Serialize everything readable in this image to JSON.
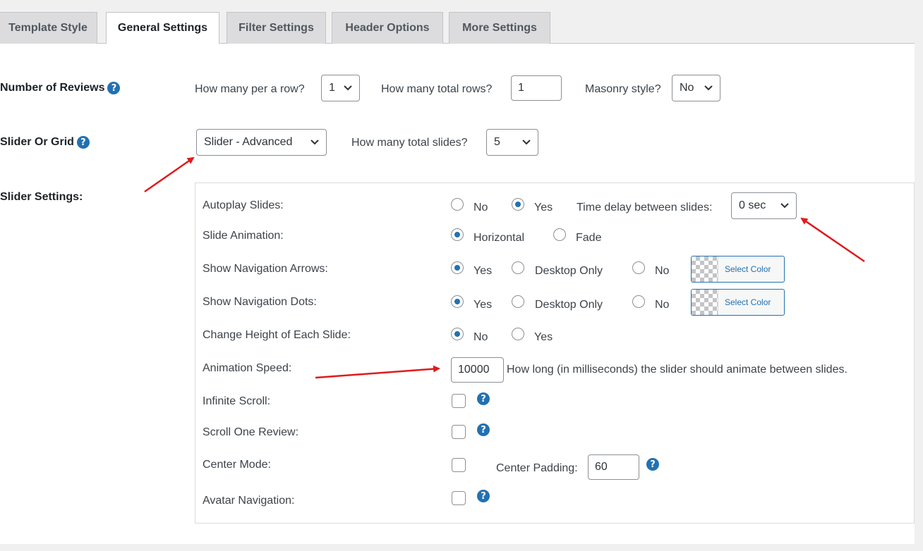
{
  "tabs": [
    {
      "label": "Template Style",
      "active": false
    },
    {
      "label": "General Settings",
      "active": true
    },
    {
      "label": "Filter Settings",
      "active": false
    },
    {
      "label": "Header Options",
      "active": false
    },
    {
      "label": "More Settings",
      "active": false
    }
  ],
  "reviews": {
    "label": "Number of Reviews",
    "per_row_label": "How many per a row?",
    "per_row_value": "1",
    "total_rows_label": "How many total rows?",
    "total_rows_value": "1",
    "masonry_label": "Masonry style?",
    "masonry_value": "No"
  },
  "slider_grid": {
    "label": "Slider Or Grid",
    "value": "Slider - Advanced",
    "total_slides_label": "How many total slides?",
    "total_slides_value": "5"
  },
  "slider_settings": {
    "label": "Slider Settings:",
    "autoplay": {
      "label": "Autoplay Slides:",
      "options": [
        "No",
        "Yes"
      ],
      "selected": "Yes",
      "delay_label": "Time delay between slides:",
      "delay_value": "0 sec"
    },
    "animation": {
      "label": "Slide Animation:",
      "options": [
        "Horizontal",
        "Fade"
      ],
      "selected": "Horizontal"
    },
    "nav_arrows": {
      "label": "Show Navigation Arrows:",
      "options": [
        "Yes",
        "Desktop Only",
        "No"
      ],
      "selected": "Yes",
      "color_button": "Select Color"
    },
    "nav_dots": {
      "label": "Show Navigation Dots:",
      "options": [
        "Yes",
        "Desktop Only",
        "No"
      ],
      "selected": "Yes",
      "color_button": "Select Color"
    },
    "height": {
      "label": "Change Height of Each Slide:",
      "options": [
        "No",
        "Yes"
      ],
      "selected": "No"
    },
    "speed": {
      "label": "Animation Speed:",
      "value": "10000",
      "help_text": "How long (in milliseconds) the slider should animate between slides."
    },
    "infinite": {
      "label": "Infinite Scroll:",
      "checked": false
    },
    "scroll_one": {
      "label": "Scroll One Review:",
      "checked": false
    },
    "center_mode": {
      "label": "Center Mode:",
      "checked": false,
      "padding_label": "Center Padding:",
      "padding_value": "60"
    },
    "avatar_nav": {
      "label": "Avatar Navigation:",
      "checked": false
    }
  },
  "help_glyph": "?",
  "colors": {
    "accent": "#2271b1",
    "annotation_arrow": "#e01b1b"
  }
}
